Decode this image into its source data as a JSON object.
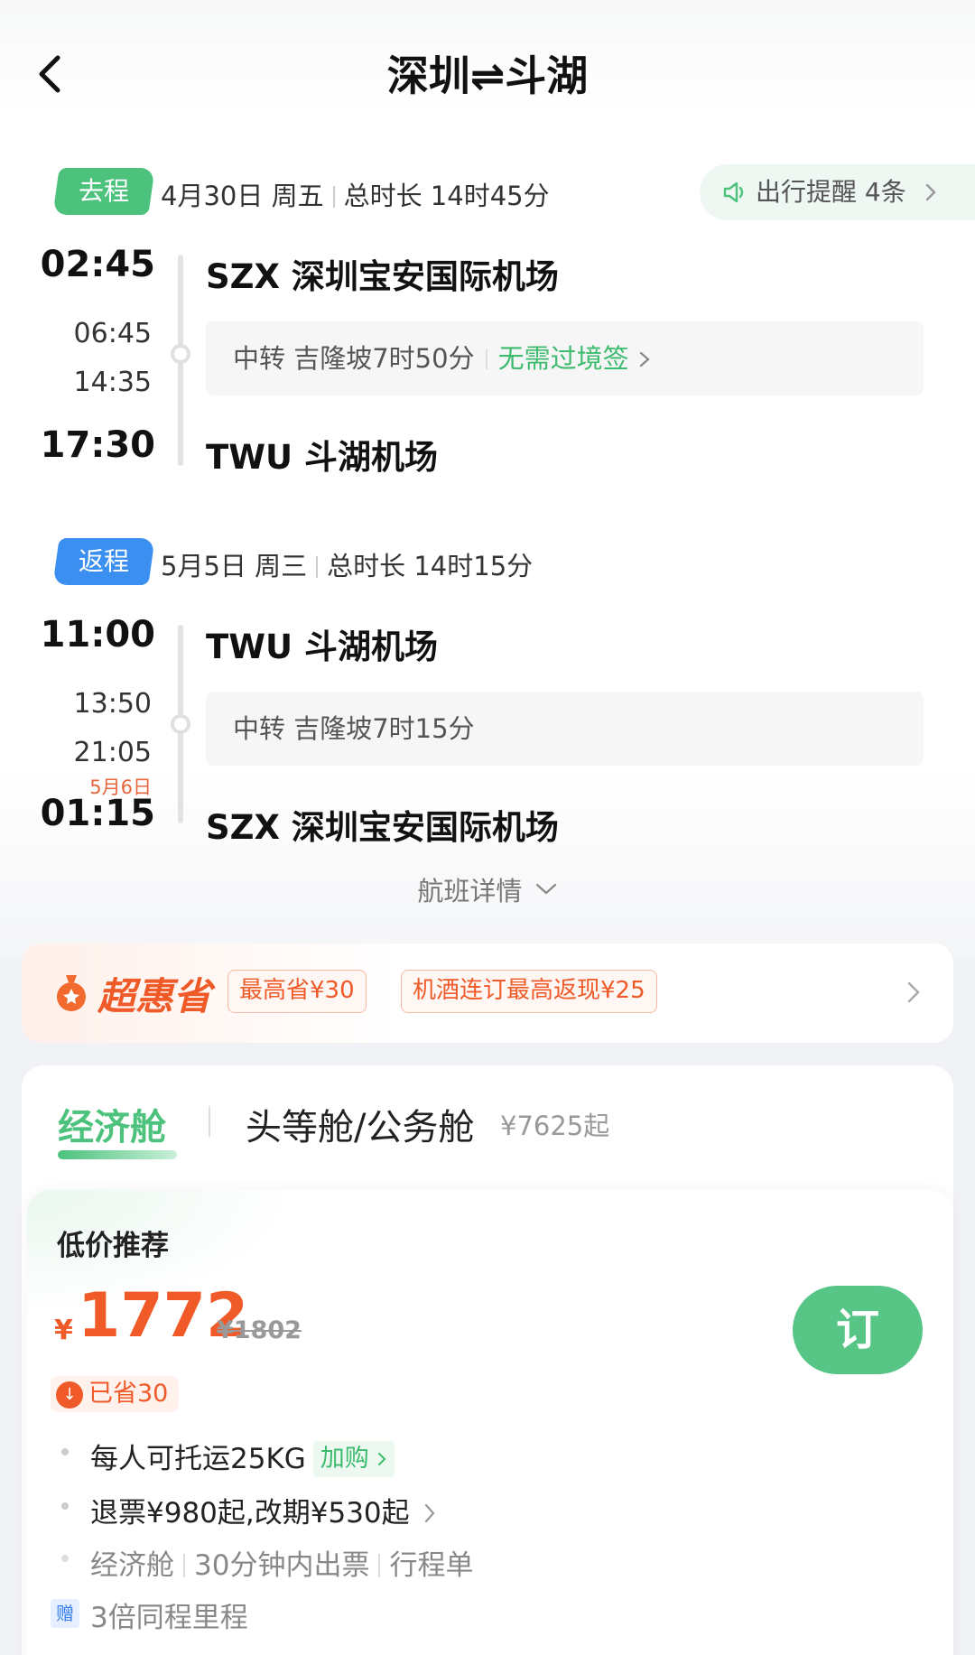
{
  "header": {
    "title": "深圳⇌斗湖"
  },
  "reminder": {
    "label": "出行提醒 4条"
  },
  "outbound": {
    "tag": "去程",
    "date": "4月30日 周五",
    "duration": "总时长 14时45分",
    "depart_time": "02:45",
    "stop_arrive": "06:45",
    "stop_depart": "14:35",
    "arrive_time": "17:30",
    "origin": "SZX 深圳宝安国际机场",
    "destination": "TWU 斗湖机场",
    "transfer": "中转 吉隆坡7时50分",
    "visa_link": "无需过境签"
  },
  "return": {
    "tag": "返程",
    "date": "5月5日 周三",
    "duration": "总时长 14时15分",
    "depart_time": "11:00",
    "stop_arrive": "13:50",
    "stop_depart": "21:05",
    "arrive_next_day": "5月6日",
    "arrive_time": "01:15",
    "origin": "TWU 斗湖机场",
    "destination": "SZX 深圳宝安国际机场",
    "transfer": "中转 吉隆坡7时15分"
  },
  "flight_detail": "航班详情",
  "promo": {
    "name": "超惠省",
    "chip1": "最高省¥30",
    "chip2": "机酒连订最高返现¥25"
  },
  "cabins": {
    "active": "经济舱",
    "other": "头等舱/公务舱",
    "other_price": "¥7625起"
  },
  "offer": {
    "title": "低价推荐",
    "currency": "¥",
    "price": "1772",
    "original_price": "¥1802",
    "book_label": "订",
    "saved": "已省30",
    "baggage": "每人可托运25KG",
    "baggage_addon": "加购",
    "refund": "退票¥980起,改期¥530起",
    "cabin_class": "经济舱",
    "ticketing": "30分钟内出票",
    "itinerary": "行程单",
    "gift_icon_label": "赠",
    "mileage": "3倍同程里程"
  },
  "colors": {
    "green": "#4cc27d",
    "blue": "#3a8ff0",
    "orange": "#f05a28"
  }
}
